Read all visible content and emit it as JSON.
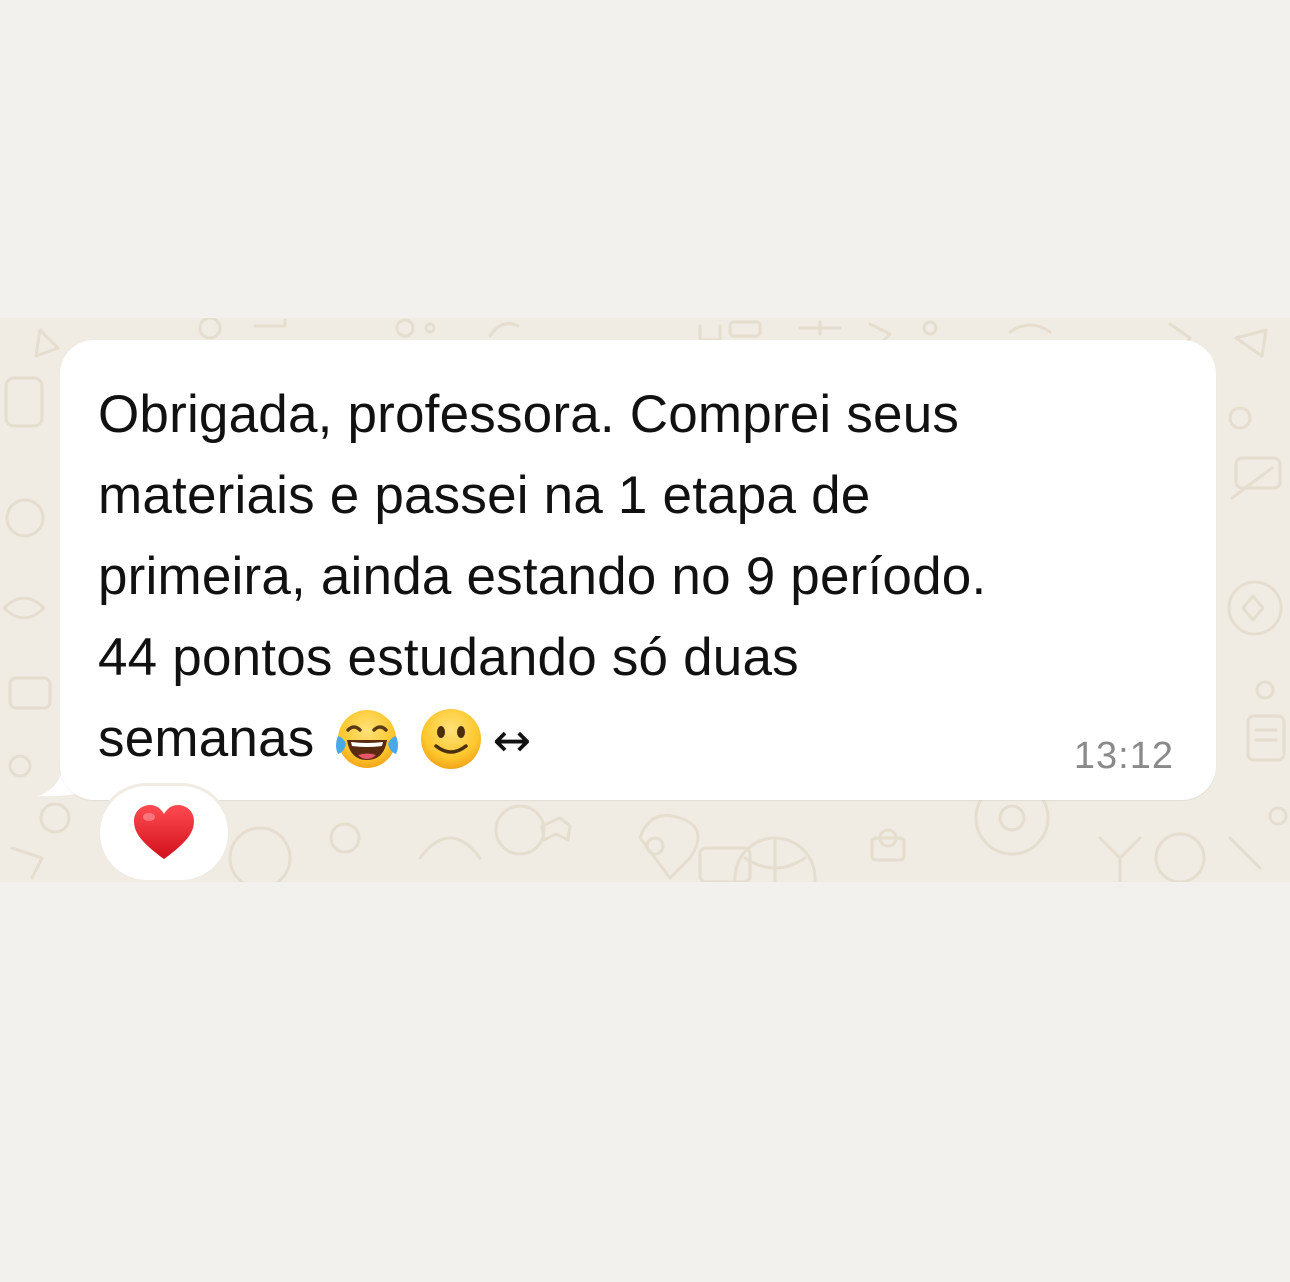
{
  "message": {
    "lines": [
      "Obrigada, professora. Comprei seus",
      "materiais e passei na 1 etapa de",
      "primeira, ainda estando no 9 período.",
      "44 pontos estudando só duas"
    ],
    "last_line_text": "semanas",
    "emojis": [
      "tears-of-joy-emoji",
      "slightly-smiling-emoji"
    ],
    "trailing_symbol": "↔",
    "time": "13:12"
  },
  "reaction": {
    "icon": "red-heart-emoji"
  },
  "colors": {
    "page_background": "#f3f1ed",
    "chat_wallpaper": "#f0ece3",
    "bubble": "#ffffff",
    "text": "#111111",
    "timestamp": "#8a8a8a",
    "heart": "#e0262f"
  }
}
